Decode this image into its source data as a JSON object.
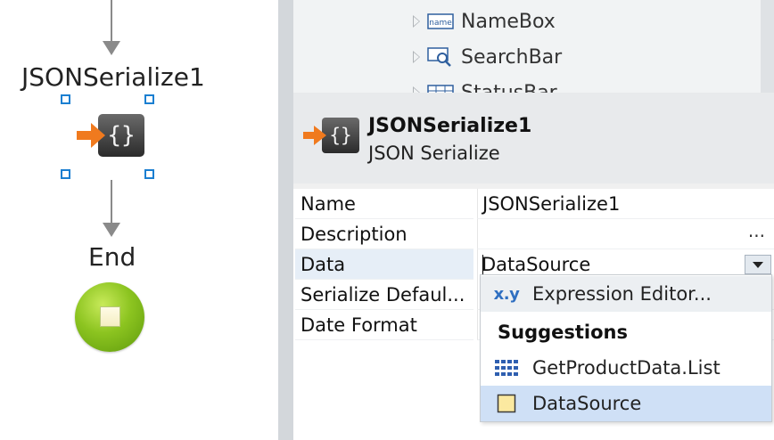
{
  "flow": {
    "node_label": "JSONSerialize1",
    "end_label": "End"
  },
  "tree": {
    "items": [
      {
        "label": "NameBox",
        "icon": "namebox-icon",
        "icon_text": "name"
      },
      {
        "label": "SearchBar",
        "icon": "searchbar-icon"
      },
      {
        "label": "StatusBar",
        "icon": "statusbar-icon"
      }
    ]
  },
  "header": {
    "title": "JSONSerialize1",
    "subtitle": "JSON Serialize",
    "icon": "json-serialize-icon"
  },
  "properties": [
    {
      "name": "Name",
      "value": "JSONSerialize1"
    },
    {
      "name": "Description",
      "value": "",
      "action": "..."
    },
    {
      "name": "Data",
      "value": "DataSource"
    },
    {
      "name": "Serialize Defaul...",
      "value": ""
    },
    {
      "name": "Date Format",
      "value": ""
    }
  ],
  "popup": {
    "expression_editor_label": "Expression Editor...",
    "expression_icon_text": "x.y",
    "suggestions_heading": "Suggestions",
    "items": [
      {
        "label": "GetProductData.List",
        "icon": "list-icon"
      },
      {
        "label": "DataSource",
        "icon": "datasource-icon",
        "selected": true
      }
    ]
  },
  "colors": {
    "selection_handle": "#1b7fd1",
    "end_node": "#8cc420",
    "node_arrow": "#f07a1e",
    "popup_selected": "#cfe0f6"
  }
}
